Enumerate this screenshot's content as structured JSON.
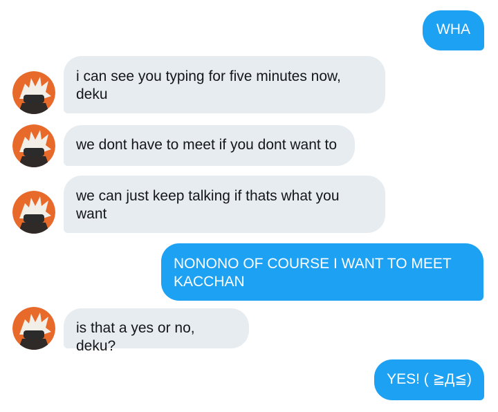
{
  "conversation": {
    "messages": [
      {
        "from": "me",
        "text": "WHA"
      },
      {
        "from": "them",
        "text": "i can see you typing for five minutes now, deku"
      },
      {
        "from": "them",
        "text": "we dont have to meet if you dont want to"
      },
      {
        "from": "them",
        "text": "we can just keep talking if thats what you want"
      },
      {
        "from": "me",
        "text": "NONONO OF COURSE I WANT TO MEET KACCHAN"
      },
      {
        "from": "them",
        "text": "is that a yes or no, deku?"
      },
      {
        "from": "me",
        "text": "YES! ( ≧Д≦)"
      }
    ]
  },
  "colors": {
    "outgoing_bubble": "#1da1f2",
    "incoming_bubble": "#e6ecf0",
    "avatar_bg": "#e86a2a"
  }
}
